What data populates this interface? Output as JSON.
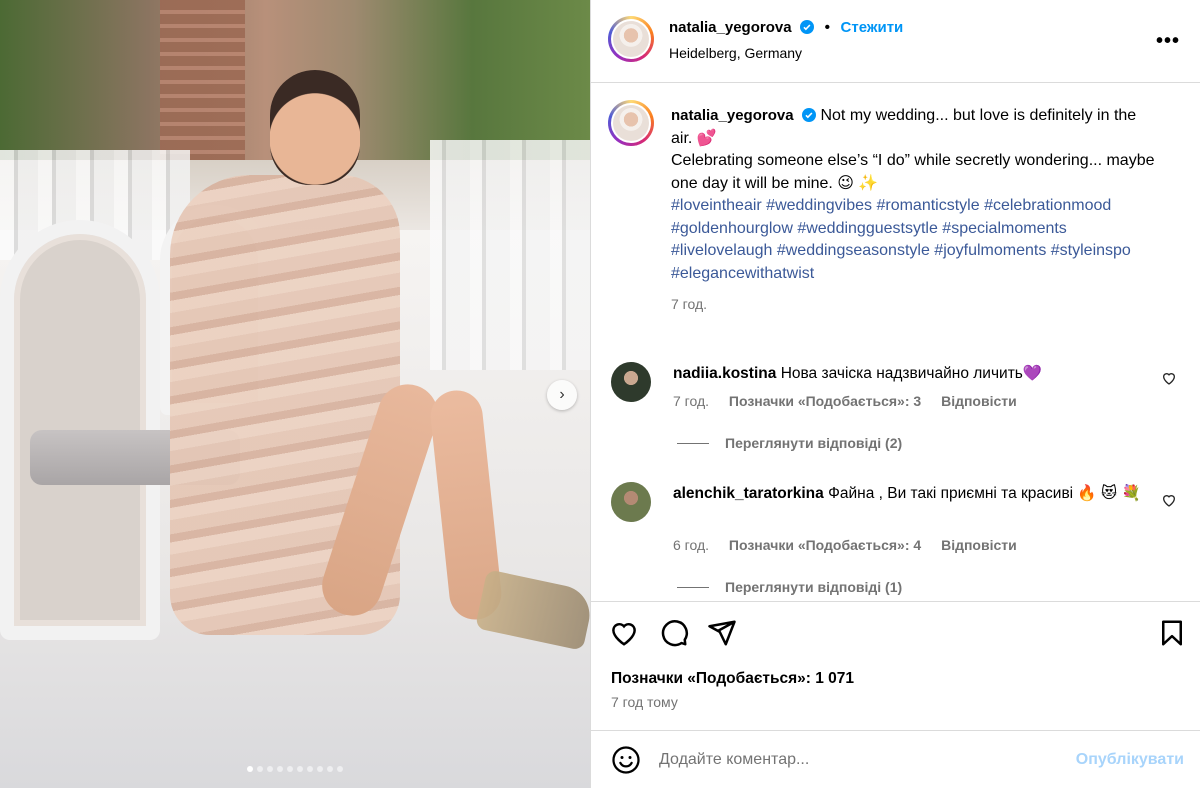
{
  "post": {
    "username": "natalia_yegorova",
    "follow_label": "Стежити",
    "separator": "•",
    "location": "Heidelberg, Germany",
    "more_icon": "more-horizontal-icon",
    "carousel": {
      "slides": 10,
      "active": 0
    }
  },
  "caption": {
    "username": "natalia_yegorova",
    "line1": "Not my wedding... but love is definitely in the air. 💕",
    "line2": "Celebrating someone else’s “I do” while secretly wondering... maybe one day it will be mine. 😉 ✨",
    "hashtags": "#loveintheair #weddingvibes #romanticstyle #celebrationmood #goldenhourglow #weddingguestsytle #specialmoments #livelovelaugh #weddingseasonstyle #joyfulmoments #styleinspo #elegancewithatwist",
    "time": "7 год."
  },
  "comments": [
    {
      "username": "nadiia.kostina",
      "text": "Нова зачіска надзвичайно личить💜",
      "time": "7 год.",
      "likes": "Позначки «Подобається»: 3",
      "reply": "Відповісти",
      "view_replies": "Переглянути відповіді (2)"
    },
    {
      "username": "alenchik_taratorkina",
      "text": "Файна , Ви такі приємні та красиві 🔥 😻 💐",
      "time": "6 год.",
      "likes": "Позначки «Подобається»: 4",
      "reply": "Відповісти",
      "view_replies": "Переглянути відповіді (1)"
    }
  ],
  "footer": {
    "likes": "Позначки «Подобається»: 1 071",
    "ago": "7 год тому",
    "comment_placeholder": "Додайте коментар...",
    "post_label": "Опублікувати"
  },
  "colors": {
    "link": "#0095f6",
    "hashtag": "#3b5998",
    "muted": "#737373",
    "border": "#dbdbdb",
    "post_disabled": "#a8d4fb"
  }
}
